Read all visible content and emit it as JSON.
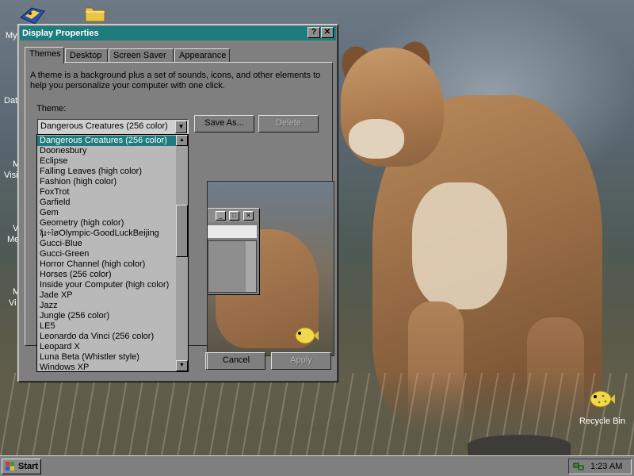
{
  "desktop": {
    "edge_labels": [
      "My",
      "Dat",
      "M",
      "Visi",
      "V",
      "Me",
      "M",
      "Vi"
    ],
    "recycle_bin_label": "Recycle Bin"
  },
  "dialog": {
    "title": "Display Properties",
    "help_button": "?",
    "close_button": "✕",
    "tabs": [
      "Themes",
      "Desktop",
      "Screen Saver",
      "Appearance"
    ],
    "description": "A theme is a background plus a set of sounds, icons, and other elements to help you personalize your computer with one click.",
    "theme_label": "Theme:",
    "selected_theme": "Dangerous Creatures (256 color)",
    "save_as_label": "Save As...",
    "delete_label": "Delete",
    "ok_label": "",
    "cancel_label": "Cancel",
    "apply_label": "Apply",
    "theme_options": [
      "Dangerous Creatures (256 color)",
      "Doonesbury",
      "Eclipse",
      "Falling Leaves (high color)",
      "Fashion (high color)",
      "FoxTrot",
      "Garfield",
      "Gem",
      "Geometry (high color)",
      "ʹ̸µ÷îøOlympic-GoodLuckBeijing",
      "Gucci-Blue",
      "Gucci-Green",
      "Horror Channel (high color)",
      "Horses (256 color)",
      "Inside your Computer (high color)",
      "Jade XP",
      "Jazz",
      "Jungle (256 color)",
      "LE5",
      "Leonardo da Vinci (256 color)",
      "Leopard X",
      "Luna Beta (Whistler style)",
      "Windows XP"
    ]
  },
  "taskbar": {
    "start_label": "Start",
    "clock": "1:23 AM"
  },
  "colors": {
    "titlebar": "#1e7c7c",
    "selection": "#1e7c7c",
    "window_face": "#7f7f7f"
  }
}
